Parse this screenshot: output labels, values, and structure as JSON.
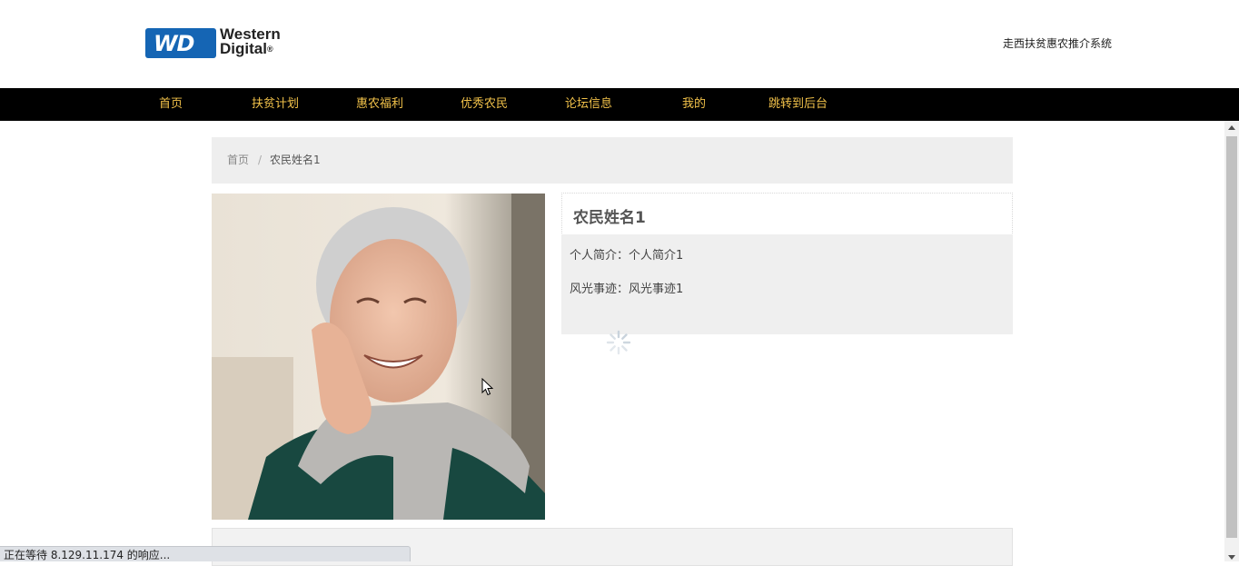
{
  "header": {
    "logo_mark": "WD",
    "logo_line1": "Western",
    "logo_line2": "Digital",
    "logo_reg": "®",
    "site_name": "走西扶贫惠农推介系统"
  },
  "nav": {
    "items": [
      {
        "label": "首页"
      },
      {
        "label": "扶贫计划"
      },
      {
        "label": "惠农福利"
      },
      {
        "label": "优秀农民"
      },
      {
        "label": "论坛信息"
      },
      {
        "label": "我的"
      },
      {
        "label": "跳转到后台"
      }
    ]
  },
  "breadcrumb": {
    "home": "首页",
    "separator": "/",
    "current": "农民姓名1"
  },
  "detail": {
    "name": "农民姓名1",
    "intro_label": "个人简介：",
    "intro_value": "个人简介1",
    "story_label": "风光事迹：",
    "story_value": "风光事迹1"
  },
  "status": {
    "text": "正在等待 8.129.11.174 的响应..."
  },
  "colors": {
    "nav_bg": "#000000",
    "nav_text": "#f2c24a",
    "logo_blue": "#1565b4",
    "panel_bg": "#eeeeee"
  }
}
